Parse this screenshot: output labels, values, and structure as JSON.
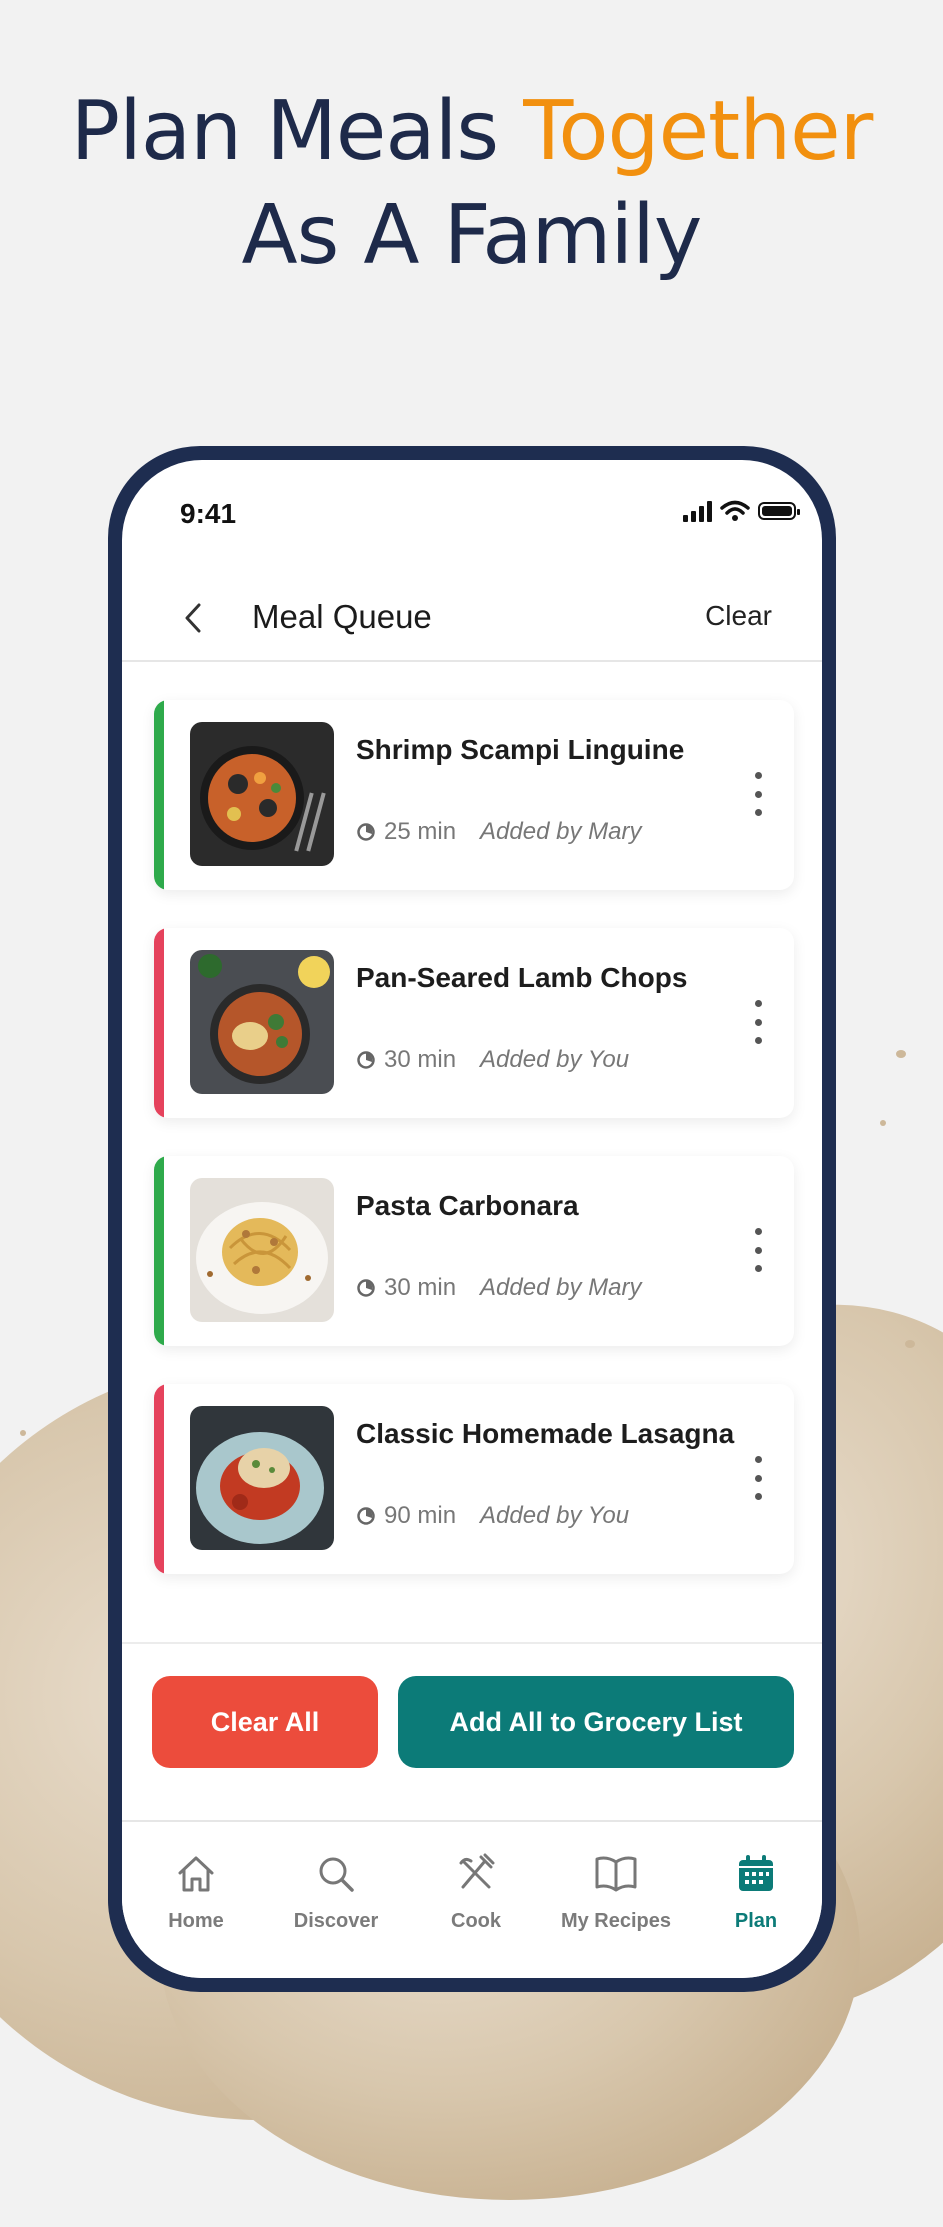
{
  "headline": {
    "line1_part1": "Plan Meals",
    "line1_part2": "Together",
    "line2": "As A Family"
  },
  "status_bar": {
    "time": "9:41"
  },
  "header": {
    "title": "Meal Queue",
    "clear_label": "Clear"
  },
  "colors": {
    "accent_orange": "#f2900f",
    "navy": "#1e2a4a",
    "teal": "#0c7b78",
    "red": "#ec4c3c",
    "bar_green": "#2eaa4b",
    "bar_red": "#e5425c"
  },
  "meals": [
    {
      "title": "Shrimp Scampi Linguine",
      "time": "25 min",
      "added_by": "Added by Mary"
    },
    {
      "title": "Pan-Seared Lamb Chops",
      "time": "30 min",
      "added_by": "Added by You"
    },
    {
      "title": "Pasta Carbonara",
      "time": "30 min",
      "added_by": "Added by Mary"
    },
    {
      "title": "Classic Homemade Lasagna",
      "time": "90 min",
      "added_by": "Added by You"
    }
  ],
  "actions": {
    "clear_all": "Clear All",
    "add_grocery": "Add All to Grocery List"
  },
  "tabs": [
    {
      "label": "Home",
      "icon": "home-icon"
    },
    {
      "label": "Discover",
      "icon": "search-icon"
    },
    {
      "label": "Cook",
      "icon": "fork-knife-icon"
    },
    {
      "label": "My Recipes",
      "icon": "book-icon"
    },
    {
      "label": "Plan",
      "icon": "calendar-icon",
      "active": true
    }
  ]
}
